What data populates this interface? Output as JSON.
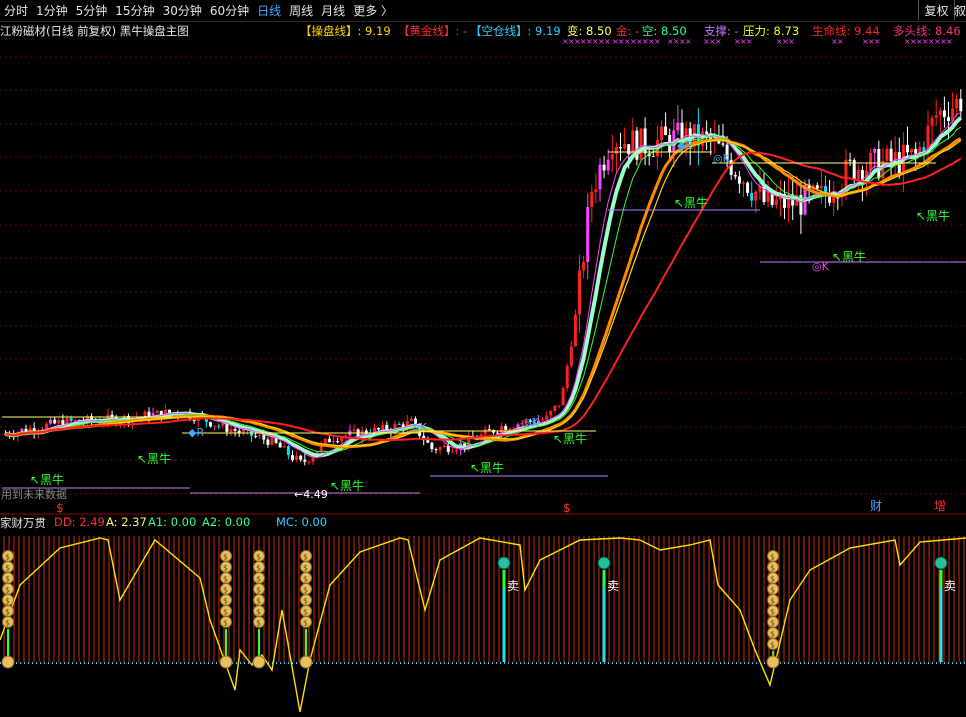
{
  "timeframes": [
    {
      "label": "分时",
      "active": false
    },
    {
      "label": "1分钟",
      "active": false
    },
    {
      "label": "5分钟",
      "active": false
    },
    {
      "label": "15分钟",
      "active": false
    },
    {
      "label": "30分钟",
      "active": false
    },
    {
      "label": "60分钟",
      "active": false
    },
    {
      "label": "日线",
      "active": true
    },
    {
      "label": "周线",
      "active": false
    },
    {
      "label": "月线",
      "active": false
    },
    {
      "label": "更多 〉",
      "active": false
    }
  ],
  "adjust_label": "复权",
  "right_edge_glyph": "叙",
  "chart_title": "江粉磁材(日线 前复权) 黑牛操盘主图",
  "legend": [
    {
      "text": "【操盘线】: 9.19",
      "color": "#ffd700"
    },
    {
      "text": "【黄金线】: -",
      "color": "#ff3030"
    },
    {
      "text": "【空仓线】: 9.19",
      "color": "#30d0ff"
    },
    {
      "text": "变: 8.50",
      "color": "#ffff66"
    },
    {
      "text": "金: -",
      "color": "#ff3030"
    },
    {
      "text": "空: 8.50",
      "color": "#30ff90"
    },
    {
      "text": "支撑: -",
      "color": "#c07cff"
    },
    {
      "text": "压力: 8.73",
      "color": "#ffff00"
    },
    {
      "text": "生命线: 9.44",
      "color": "#ff2020"
    },
    {
      "text": "多头线: 8.46",
      "color": "#ff3080"
    }
  ],
  "annotations": {
    "heiniu": "黑牛",
    "r_mark": "◆R",
    "k_mark": "◎K",
    "price_low": "4.49",
    "future_data": "用到未来数据",
    "cai": "财",
    "zeng": "增",
    "dollar": "$",
    "sell": "卖"
  },
  "lower": {
    "name": "家财万贯",
    "values": [
      {
        "text": "DD: 2.49",
        "color": "#ff3030"
      },
      {
        "text": "A: 2.37",
        "color": "#ffff66"
      },
      {
        "text": "A1: 0.00",
        "color": "#30ff90"
      },
      {
        "text": "A2: 0.00",
        "color": "#30ff90"
      },
      {
        "text": "MC: 0.00",
        "color": "#30d0ff"
      }
    ]
  },
  "chart_data": {
    "type": "candlestick",
    "ylim": [
      4.2,
      10.2
    ],
    "candles": [],
    "lines": {}
  }
}
